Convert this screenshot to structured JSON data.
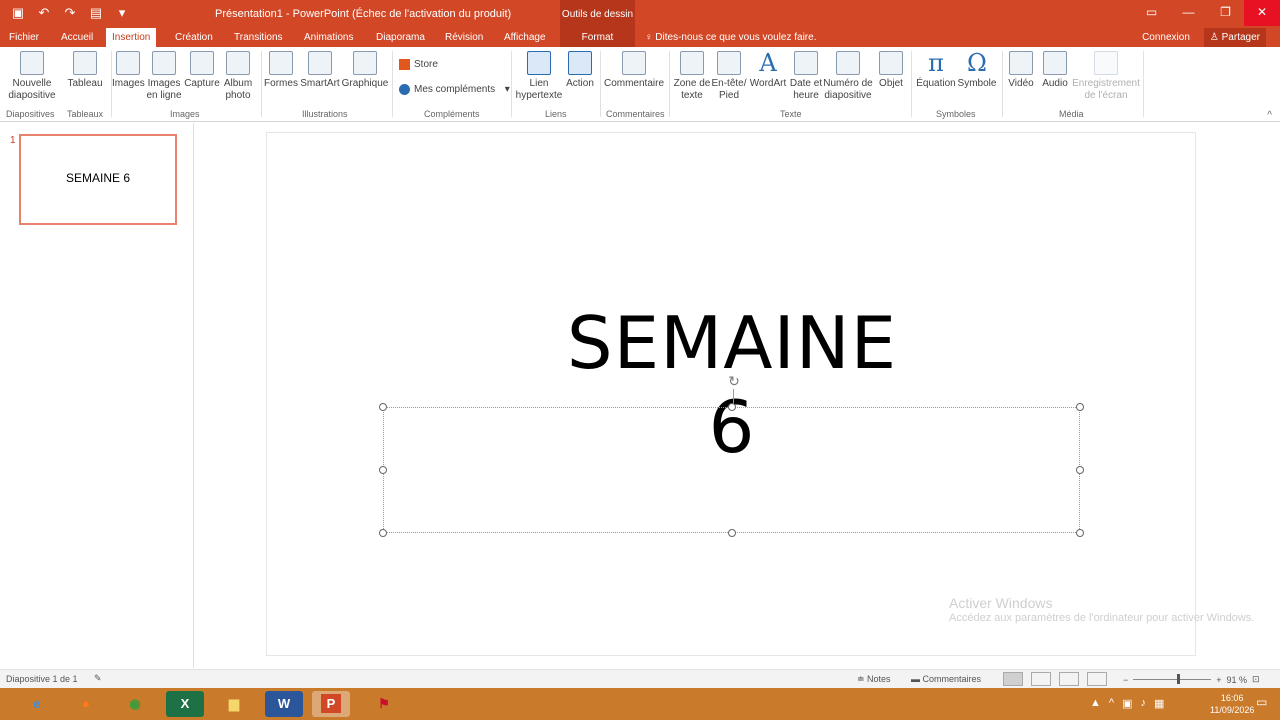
{
  "window": {
    "title": "Présentation1 - PowerPoint (Échec de l'activation du produit)",
    "contextual_group": "Outils de dessin"
  },
  "tabs": [
    {
      "label": "Fichier"
    },
    {
      "label": "Accueil"
    },
    {
      "label": "Insertion"
    },
    {
      "label": "Création"
    },
    {
      "label": "Transitions"
    },
    {
      "label": "Animations"
    },
    {
      "label": "Diaporama"
    },
    {
      "label": "Révision"
    },
    {
      "label": "Affichage"
    },
    {
      "label": "Format"
    }
  ],
  "tell_me": "Dites-nous ce que vous voulez faire.",
  "account": {
    "signin": "Connexion",
    "share": "Partager"
  },
  "ribbon": {
    "buttons": {
      "new_slide": "Nouvelle diapositive",
      "table": "Tableau",
      "images": "Images",
      "online_images": "Images en ligne",
      "screenshot": "Capture",
      "album": "Album photo",
      "shapes": "Formes",
      "smartart": "SmartArt",
      "chart": "Graphique",
      "store": "Store",
      "my_addins": "Mes compléments",
      "hyperlink": "Lien hypertexte",
      "action": "Action",
      "comment": "Commentaire",
      "textbox": "Zone de texte",
      "header_footer": "En-tête/ Pied",
      "wordart": "WordArt",
      "date_time": "Date et heure",
      "slide_number": "Numéro de diapositive",
      "object": "Objet",
      "equation": "Équation",
      "symbol": "Symbole",
      "video": "Vidéo",
      "audio": "Audio",
      "screen_recording": "Enregistrement de l'écran"
    },
    "groups": {
      "slides": "Diapositives",
      "tables": "Tableaux",
      "images": "Images",
      "illustrations": "Illustrations",
      "addins": "Compléments",
      "links": "Liens",
      "comments": "Commentaires",
      "text": "Texte",
      "symbols": "Symboles",
      "media": "Média"
    }
  },
  "thumbnails": [
    {
      "number": "1",
      "title": "SEMAINE 6"
    }
  ],
  "slide": {
    "title": "SEMAINE 6",
    "subtitle": ""
  },
  "watermark": {
    "title": "Activer Windows",
    "line": "Accédez aux paramètres de l'ordinateur pour activer Windows."
  },
  "status": {
    "slide_info": "Diapositive 1 de 1",
    "notes": "Notes",
    "comments": "Commentaires",
    "zoom": "91 %"
  },
  "taskbar": {
    "clock_time": "16:06",
    "clock_date": "11/09/2026"
  },
  "colors": {
    "accent": "#d24726",
    "accent_dark": "#b5361a",
    "taskbar": "#c97a2b"
  }
}
